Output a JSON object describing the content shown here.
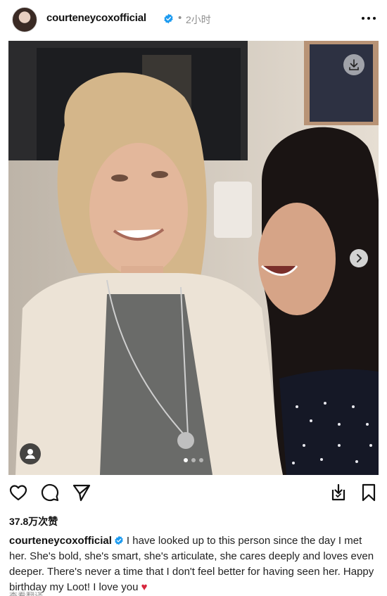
{
  "post": {
    "username": "courteneycoxofficial",
    "separator": "•",
    "time_ago": "2小时",
    "likes": "37.8万次赞",
    "caption_text": "I have looked up to this person since the day I met her. She's bold, she's smart, she's articulate, she cares deeply and loves even deeper. There's never a time that I don't feel better for having seen her. Happy birthday my Loot! I love you",
    "caption_emoji": "♥",
    "view_translation": "查看翻译"
  },
  "carousel": {
    "current": 1,
    "total": 3
  },
  "colors": {
    "verified_blue": "#1d9bf0",
    "heart_red": "#d7263d",
    "muted_gray": "#8e8e8e"
  },
  "icons": [
    "avatar",
    "verified-badge-icon",
    "more-options-icon",
    "download-icon",
    "chevron-right-icon",
    "user-tag-icon",
    "like-heart-icon",
    "comment-icon",
    "share-icon",
    "save-to-collection-icon",
    "bookmark-icon"
  ]
}
